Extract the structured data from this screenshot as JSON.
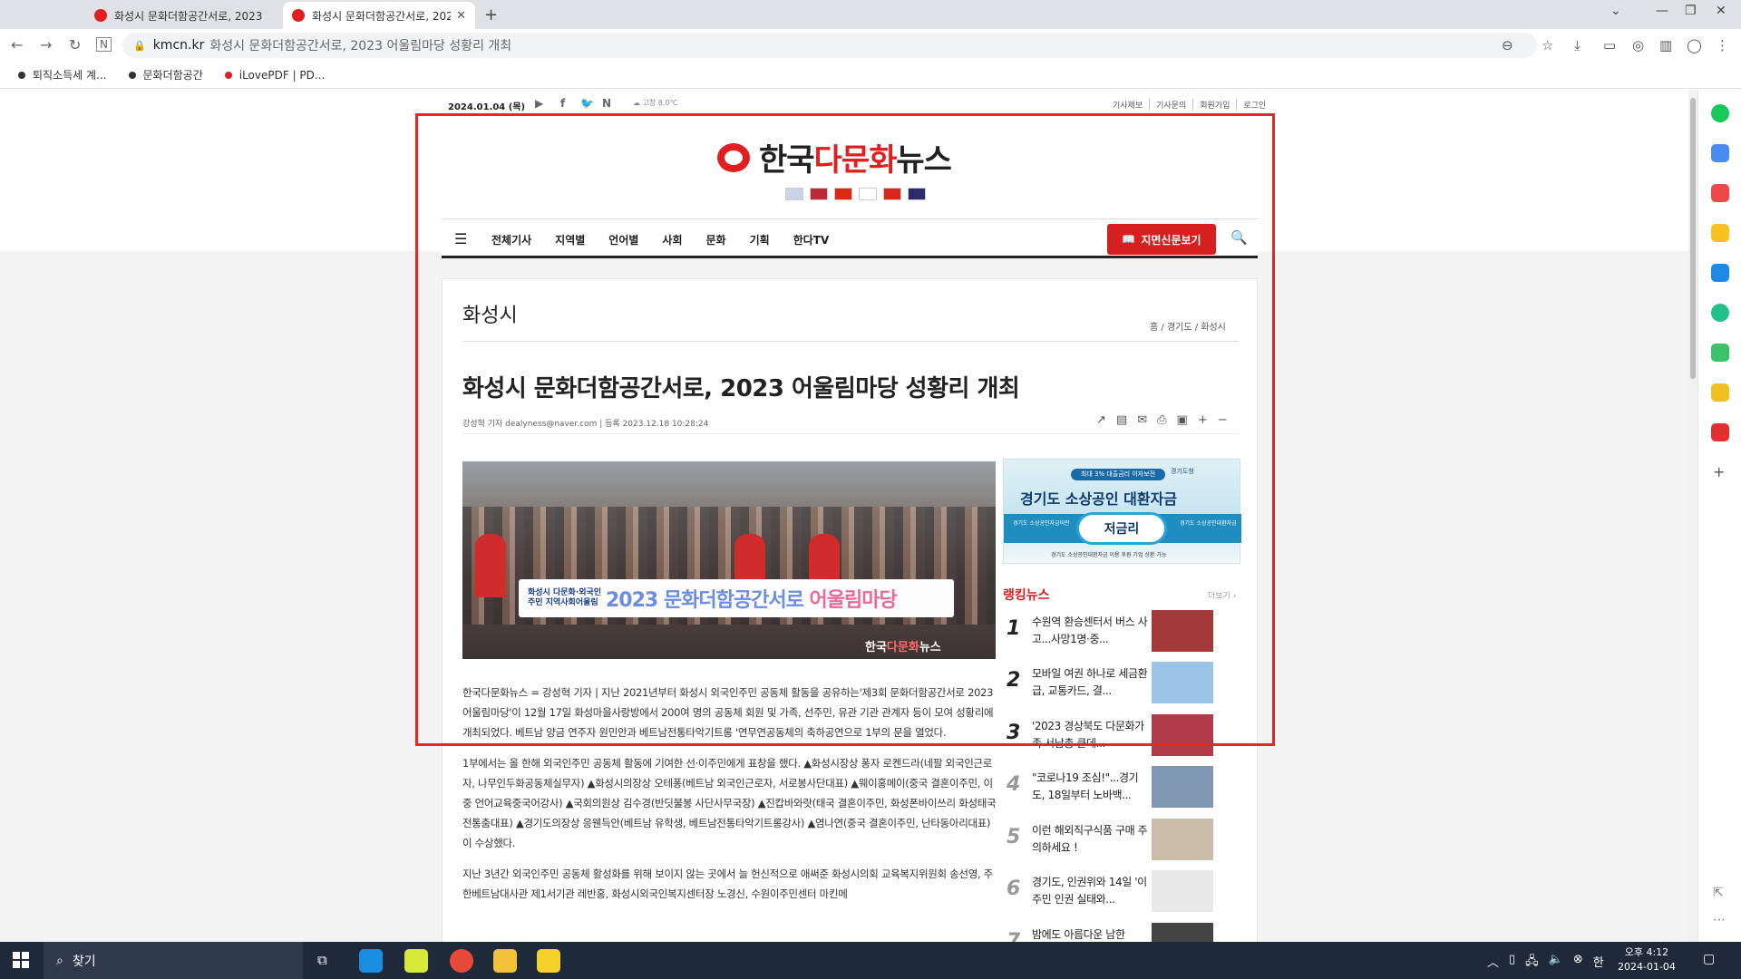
{
  "browser": {
    "tabs": [
      {
        "label": "화성시 문화더함공간서로, 2023"
      },
      {
        "label": "화성시 문화더함공간서로, 2023"
      }
    ],
    "new_tab": "+",
    "url_host": "kmcn.kr",
    "url_title": "화성시 문화더함공간서로, 2023 어울림마당 성황리 개최",
    "bookmarks": [
      {
        "label": "퇴직소득세 계...",
        "color": "#333333"
      },
      {
        "label": "문화더함공간",
        "color": "#333333"
      },
      {
        "label": "iLovePDF | PD...",
        "color": "#e02020"
      }
    ]
  },
  "site": {
    "date": "2024.01.04 (목)",
    "weather": "고창 8.0℃",
    "top_links": [
      "기사제보",
      "기사문의",
      "회원가입",
      "로그인"
    ],
    "logo_prefix": "한국",
    "logo_red": "다문화",
    "logo_suffix": "뉴스",
    "flag_colors": [
      "#c9d4e6",
      "#bf2a3a",
      "#de2910",
      "#ffffff",
      "#da251d",
      "#2d2a6a"
    ],
    "menu": [
      "전체기사",
      "지역별",
      "언어별",
      "사회",
      "문화",
      "기획",
      "한다TV"
    ],
    "paper_button": "지면신문보기"
  },
  "article": {
    "section": "화성시",
    "breadcrumb": "홈 / 경기도 / 화성시",
    "headline": "화성시 문화더함공간서로, 2023 어울림마당 성황리 개최",
    "byline": "강성혁 기자 dealyness@naver.com   |   등록 2023.12.18 10:28:24",
    "photo_banner_sub": "화성시 다문화·외국인주민 지역사회어울림",
    "photo_banner_year": "2023",
    "photo_banner_main": "문화더함공간서로",
    "photo_banner_pink": "어울림마당",
    "photo_watermark_prefix": "한국",
    "photo_watermark_red": "다문화",
    "photo_watermark_suffix": "뉴스",
    "paragraphs": [
      "한국다문화뉴스 = 강성혁 기자 | 지난 2021년부터 화성시 외국인주민 공동체 활동을 공유하는'제3회 문화더함공간서로 2023 어울림마당'이 12월 17일 화성마을사랑방에서 200여 명의 공동체 회원 및 가족, 선주민, 유관 기관 관계자 등이 모여 성황리에 개최되었다. 베트남 양금 연주자 원민안과 베트남전통타악기트롱 '연무연공동체의 축하공연으로 1부의 문을 열었다.",
      "1부에서는 올 한해 외국인주민 공동체 활동에 기여한 선·이주민에게 표창을 했다. ▲화성시장상 퐁자 로켄드라(네팔 외국인근로자, 나무인두화공동체실무자) ▲화성시의장상 오테퐁(베트남 외국인근로자, 서로봉사단대표) ▲웨이홍메이(중국 결혼이주민, 이중 언어교육중국어강사) ▲국회의원상 김수경(반딧불봉 사단사무국장) ▲진캅바와랏(태국 결혼이주민, 화성폰바이쓰리 화성태국전통춤대표) ▲경기도의장상 응웬득안(베트남 유학생, 베트남전통타악기트롱강사) ▲염나연(중국 결혼이주민, 난타동아리대표)이 수상했다.",
      "지난 3년간 외국인주민 공동체 활성화를 위해 보이지 않는 곳에서 늘 헌신적으로 애써준 화성시의회 교육복지위원회 송선영, 주한베트남대사관 제1서기관 레반홍, 화성시외국인복지센터장 노경신, 수원이주민센터 마킨메"
    ]
  },
  "ad": {
    "pill": "최대 3% 대출금리 이자보전",
    "gov": "경기도청",
    "title": "경기도 소상공인 대환자금",
    "left": "경기도 소상공인자금이란",
    "center": "저금리",
    "right": "경기도 소상공인대환자금",
    "foot": "경기도 소상공인대환자금 이용 후원 기업 상환 가능"
  },
  "ranking": {
    "title": "랭킹뉴스",
    "more": "더보기",
    "items": [
      {
        "num": "1",
        "text": "수원역 환승센터서 버스 사고...사망1명·중...",
        "thumb": "#a33a3a"
      },
      {
        "num": "2",
        "text": "모바일 여권 하나로 세금환급, 교통카드, 결...",
        "thumb": "#9cc4e6"
      },
      {
        "num": "3",
        "text": "'2023 경상북도 다문화가족 서남총 큰데...",
        "thumb": "#b03a4a"
      },
      {
        "num": "4",
        "text": "\"코로나19 조심!\"...경기도, 18일부터 노바백...",
        "thumb": "#7f97b0"
      },
      {
        "num": "5",
        "text": "이런 해외직구식품 구매 주의하세요 !",
        "thumb": "#c8bda8"
      },
      {
        "num": "6",
        "text": "경기도, 인권위와 14일 '이주민 인권 실태와...",
        "thumb": "#e8e8e8"
      },
      {
        "num": "7",
        "text": "밤에도 아름다운 남한",
        "thumb": "#444444"
      }
    ]
  },
  "taskbar": {
    "search_label": "찾기",
    "apps": [
      "#1a8de0",
      "#d6e83a",
      "#e84a3a",
      "#f2c23a",
      "#f5d22a"
    ],
    "clock_time": "오후 4:12",
    "clock_date": "2024-01-04",
    "ime": "한"
  },
  "sidebar_colors": [
    "#18c858",
    "#4a8cf0",
    "#f04848",
    "#f7c21e",
    "#1e88e5",
    "#21c28a",
    "#3ac46a",
    "#f0c020",
    "#e03030"
  ]
}
